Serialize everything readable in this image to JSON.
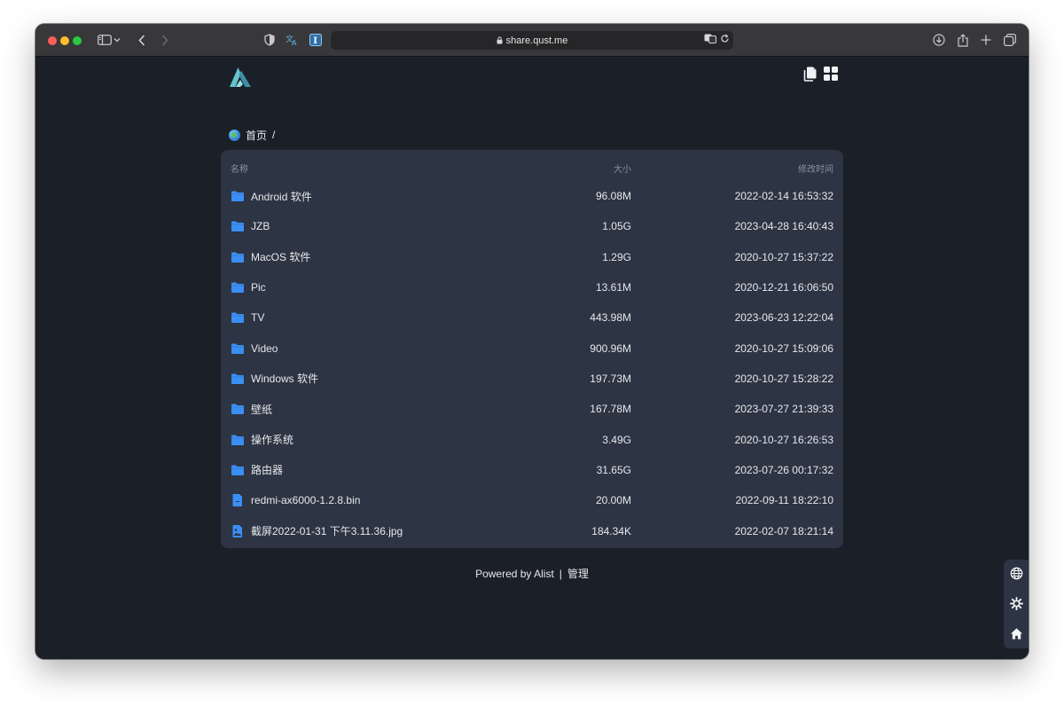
{
  "browser": {
    "url": "share.qust.me"
  },
  "breadcrumb": {
    "home_label": "首页",
    "separator": "/"
  },
  "table": {
    "headers": {
      "name": "名称",
      "size": "大小",
      "modified": "修改时间"
    },
    "rows": [
      {
        "type": "folder",
        "name": "Android 软件",
        "size": "96.08M",
        "modified": "2022-02-14 16:53:32"
      },
      {
        "type": "folder",
        "name": "JZB",
        "size": "1.05G",
        "modified": "2023-04-28 16:40:43"
      },
      {
        "type": "folder",
        "name": "MacOS 软件",
        "size": "1.29G",
        "modified": "2020-10-27 15:37:22"
      },
      {
        "type": "folder",
        "name": "Pic",
        "size": "13.61M",
        "modified": "2020-12-21 16:06:50"
      },
      {
        "type": "folder",
        "name": "TV",
        "size": "443.98M",
        "modified": "2023-06-23 12:22:04"
      },
      {
        "type": "folder",
        "name": "Video",
        "size": "900.96M",
        "modified": "2020-10-27 15:09:06"
      },
      {
        "type": "folder",
        "name": "Windows 软件",
        "size": "197.73M",
        "modified": "2020-10-27 15:28:22"
      },
      {
        "type": "folder",
        "name": "壁纸",
        "size": "167.78M",
        "modified": "2023-07-27 21:39:33"
      },
      {
        "type": "folder",
        "name": "操作系统",
        "size": "3.49G",
        "modified": "2020-10-27 16:26:53"
      },
      {
        "type": "folder",
        "name": "路由器",
        "size": "31.65G",
        "modified": "2023-07-26 00:17:32"
      },
      {
        "type": "file",
        "name": "redmi-ax6000-1.2.8.bin",
        "size": "20.00M",
        "modified": "2022-09-11 18:22:10"
      },
      {
        "type": "image",
        "name": "截屏2022-01-31 下午3.11.36.jpg",
        "size": "184.34K",
        "modified": "2022-02-07 18:21:14"
      }
    ]
  },
  "footer": {
    "powered_by": "Powered by Alist",
    "separator": "|",
    "admin_link": "管理"
  },
  "colors": {
    "page_bg": "#1b1f28",
    "card_bg": "#2d3443",
    "accent": "#3a8ff5",
    "logo": "#64c3cf"
  },
  "icons": {
    "header": [
      "copy-icon",
      "grid-view-icon"
    ],
    "side": [
      "globe-icon",
      "settings-icon",
      "home-icon"
    ]
  }
}
